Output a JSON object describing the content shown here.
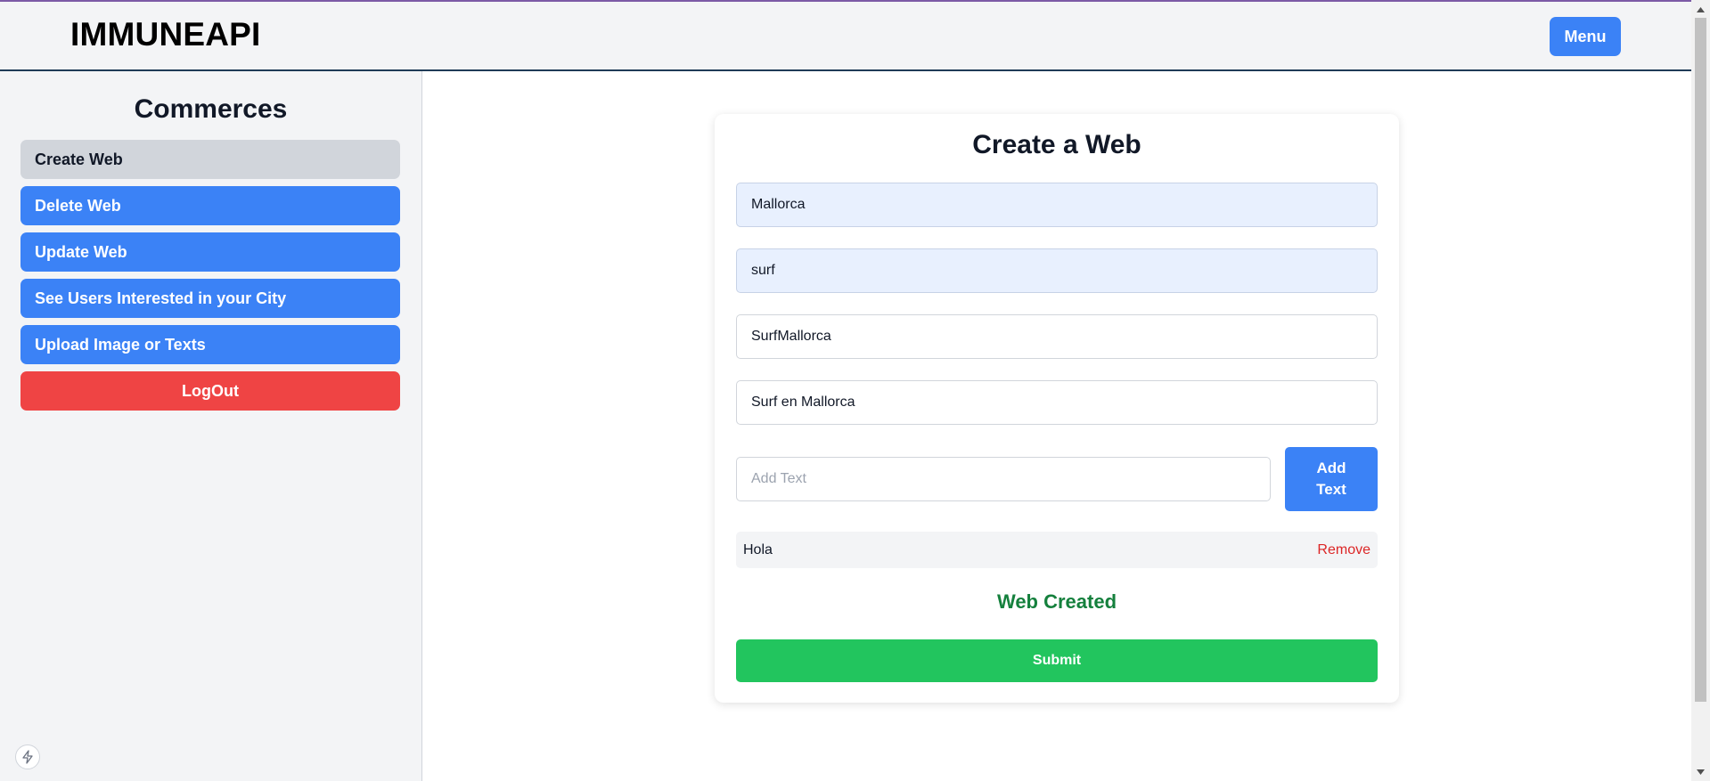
{
  "header": {
    "brand": "IMMUNEAPI",
    "menu_label": "Menu"
  },
  "sidebar": {
    "title": "Commerces",
    "items": [
      {
        "label": "Create Web",
        "active": true
      },
      {
        "label": "Delete Web"
      },
      {
        "label": "Update Web"
      },
      {
        "label": "See Users Interested in your City"
      },
      {
        "label": "Upload Image or Texts"
      }
    ],
    "logout_label": "LogOut"
  },
  "form": {
    "title": "Create a Web",
    "fields": [
      {
        "value": "Mallorca"
      },
      {
        "value": "surf"
      },
      {
        "value": "SurfMallorca"
      },
      {
        "value": "Surf en Mallorca"
      }
    ],
    "add_text": {
      "placeholder": "Add Text",
      "button_label": "Add Text"
    },
    "texts": [
      {
        "label": "Hola",
        "remove_label": "Remove"
      }
    ],
    "status": "Web Created",
    "submit_label": "Submit"
  },
  "colors": {
    "primary": "#3b82f6",
    "danger": "#ef4444",
    "success": "#22c55e",
    "success_text": "#15803d",
    "sidebar_active": "#d1d5db"
  }
}
